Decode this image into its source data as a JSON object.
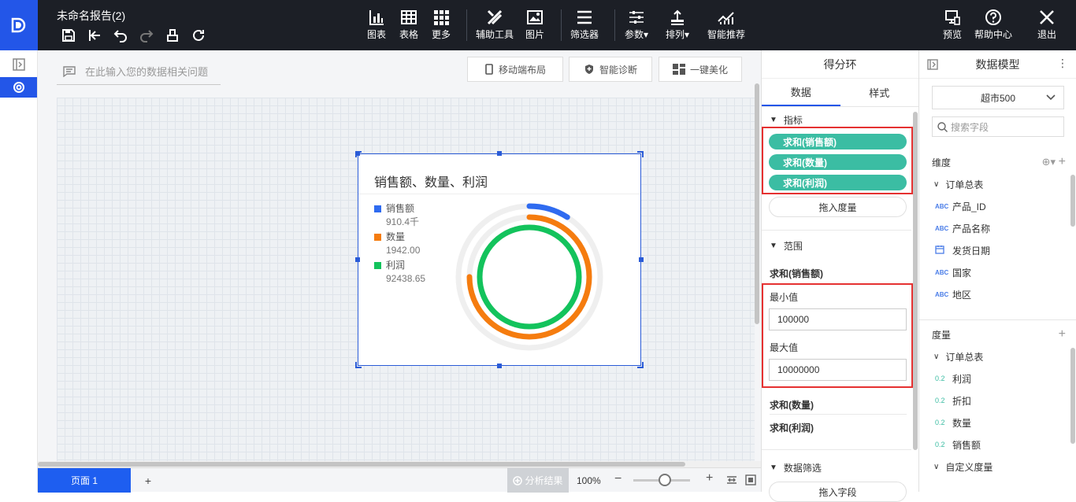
{
  "app": {
    "doc_title": "未命名报告(2)"
  },
  "toolbar": {
    "items": [
      {
        "label": "图表",
        "icon": "bar-chart-icon"
      },
      {
        "label": "表格",
        "icon": "table-icon"
      },
      {
        "label": "更多",
        "icon": "grid-icon"
      },
      {
        "label": "辅助工具",
        "icon": "tools-icon"
      },
      {
        "label": "图片",
        "icon": "image-icon"
      },
      {
        "label": "筛选器",
        "icon": "filter-icon"
      },
      {
        "label": "参数",
        "icon": "params-icon"
      },
      {
        "label": "排列",
        "icon": "arrange-icon"
      },
      {
        "label": "智能推荐",
        "icon": "recommend-icon"
      }
    ],
    "right": [
      {
        "label": "预览",
        "icon": "preview-icon"
      },
      {
        "label": "帮助中心",
        "icon": "help-icon"
      },
      {
        "label": "退出",
        "icon": "close-icon"
      }
    ]
  },
  "canvas": {
    "ask_placeholder": "在此输入您的数据相关问题",
    "buttons": {
      "mobile": "移动端布局",
      "diagnose": "智能诊断",
      "beautify": "一键美化"
    }
  },
  "chart_card": {
    "title": "销售额、数量、利润"
  },
  "chart_data": {
    "type": "ring",
    "title": "销售额、数量、利润",
    "series": [
      {
        "name": "销售额",
        "display": "910.4千",
        "value": 910400,
        "fraction": 0.09,
        "color": "#2f6bf0"
      },
      {
        "name": "数量",
        "display": "1942.00",
        "value": 1942,
        "fraction": 0.75,
        "color": "#f57c0f"
      },
      {
        "name": "利润",
        "display": "92438.65",
        "value": 92438.65,
        "fraction": 1.0,
        "color": "#13c35c"
      }
    ],
    "range": {
      "min": 100000,
      "max": 10000000
    }
  },
  "bottom": {
    "page_label": "页面 1",
    "add": "+",
    "analysis": "分析结果",
    "zoom": "100%"
  },
  "config": {
    "title": "得分环",
    "tabs": [
      "数据",
      "样式"
    ],
    "metrics_label": "指标",
    "metrics": [
      "求和(销售额)",
      "求和(数量)",
      "求和(利润)"
    ],
    "drop_measure": "拖入度量",
    "range_label": "范围",
    "range_field": "求和(销售额)",
    "min_label": "最小值",
    "min_value": "100000",
    "max_label": "最大值",
    "max_value": "10000000",
    "extra_fields": [
      "求和(数量)",
      "求和(利润)"
    ],
    "filter_label": "数据筛选",
    "filter_drop": "拖入字段"
  },
  "model": {
    "title": "数据模型",
    "dataset": "超市500",
    "search_placeholder": "搜索字段",
    "dims_label": "维度",
    "dims_table": "订单总表",
    "dims": [
      {
        "type": "ABC",
        "name": "产品_ID"
      },
      {
        "type": "ABC",
        "name": "产品名称"
      },
      {
        "type": "date",
        "name": "发货日期"
      },
      {
        "type": "ABC",
        "name": "国家"
      },
      {
        "type": "ABC",
        "name": "地区"
      }
    ],
    "measures_label": "度量",
    "measures_table": "订单总表",
    "measures": [
      "利润",
      "折扣",
      "数量",
      "销售额"
    ],
    "measure_type": "0.2",
    "custom": "自定义度量"
  }
}
